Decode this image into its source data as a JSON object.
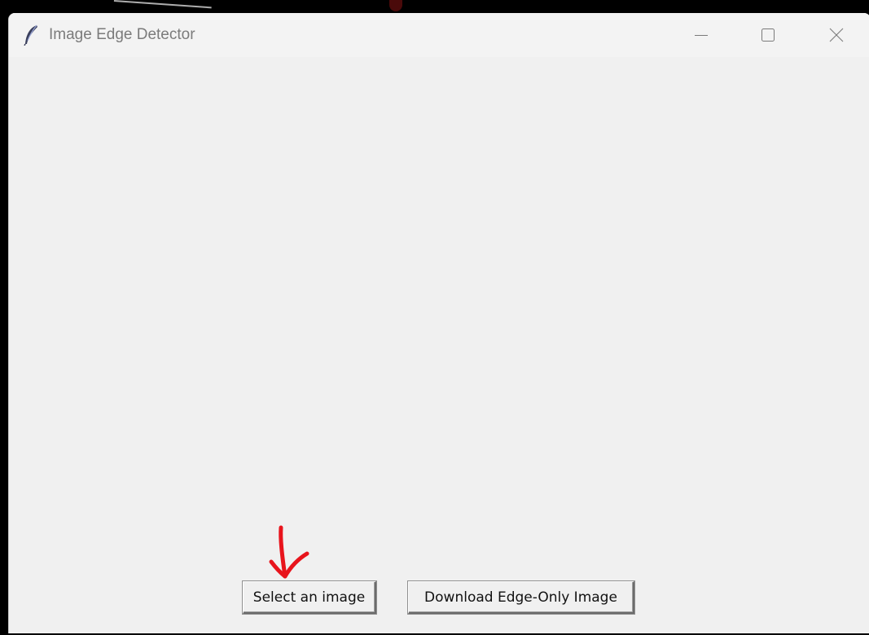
{
  "window": {
    "title": "Image Edge Detector",
    "app_icon": "feather-icon"
  },
  "titlebar_controls": {
    "minimize_icon": "minimize-icon",
    "maximize_icon": "maximize-icon",
    "close_icon": "close-icon"
  },
  "buttons": {
    "select_image_label": "Select an image",
    "download_label": "Download Edge-Only Image"
  },
  "annotation": {
    "type": "hand-drawn-arrow",
    "color": "#e8141c",
    "points_to": "Select an image"
  },
  "colors": {
    "window_bg": "#f0f0f0",
    "title_text": "#7b7b7b",
    "arrow": "#e8141c"
  }
}
